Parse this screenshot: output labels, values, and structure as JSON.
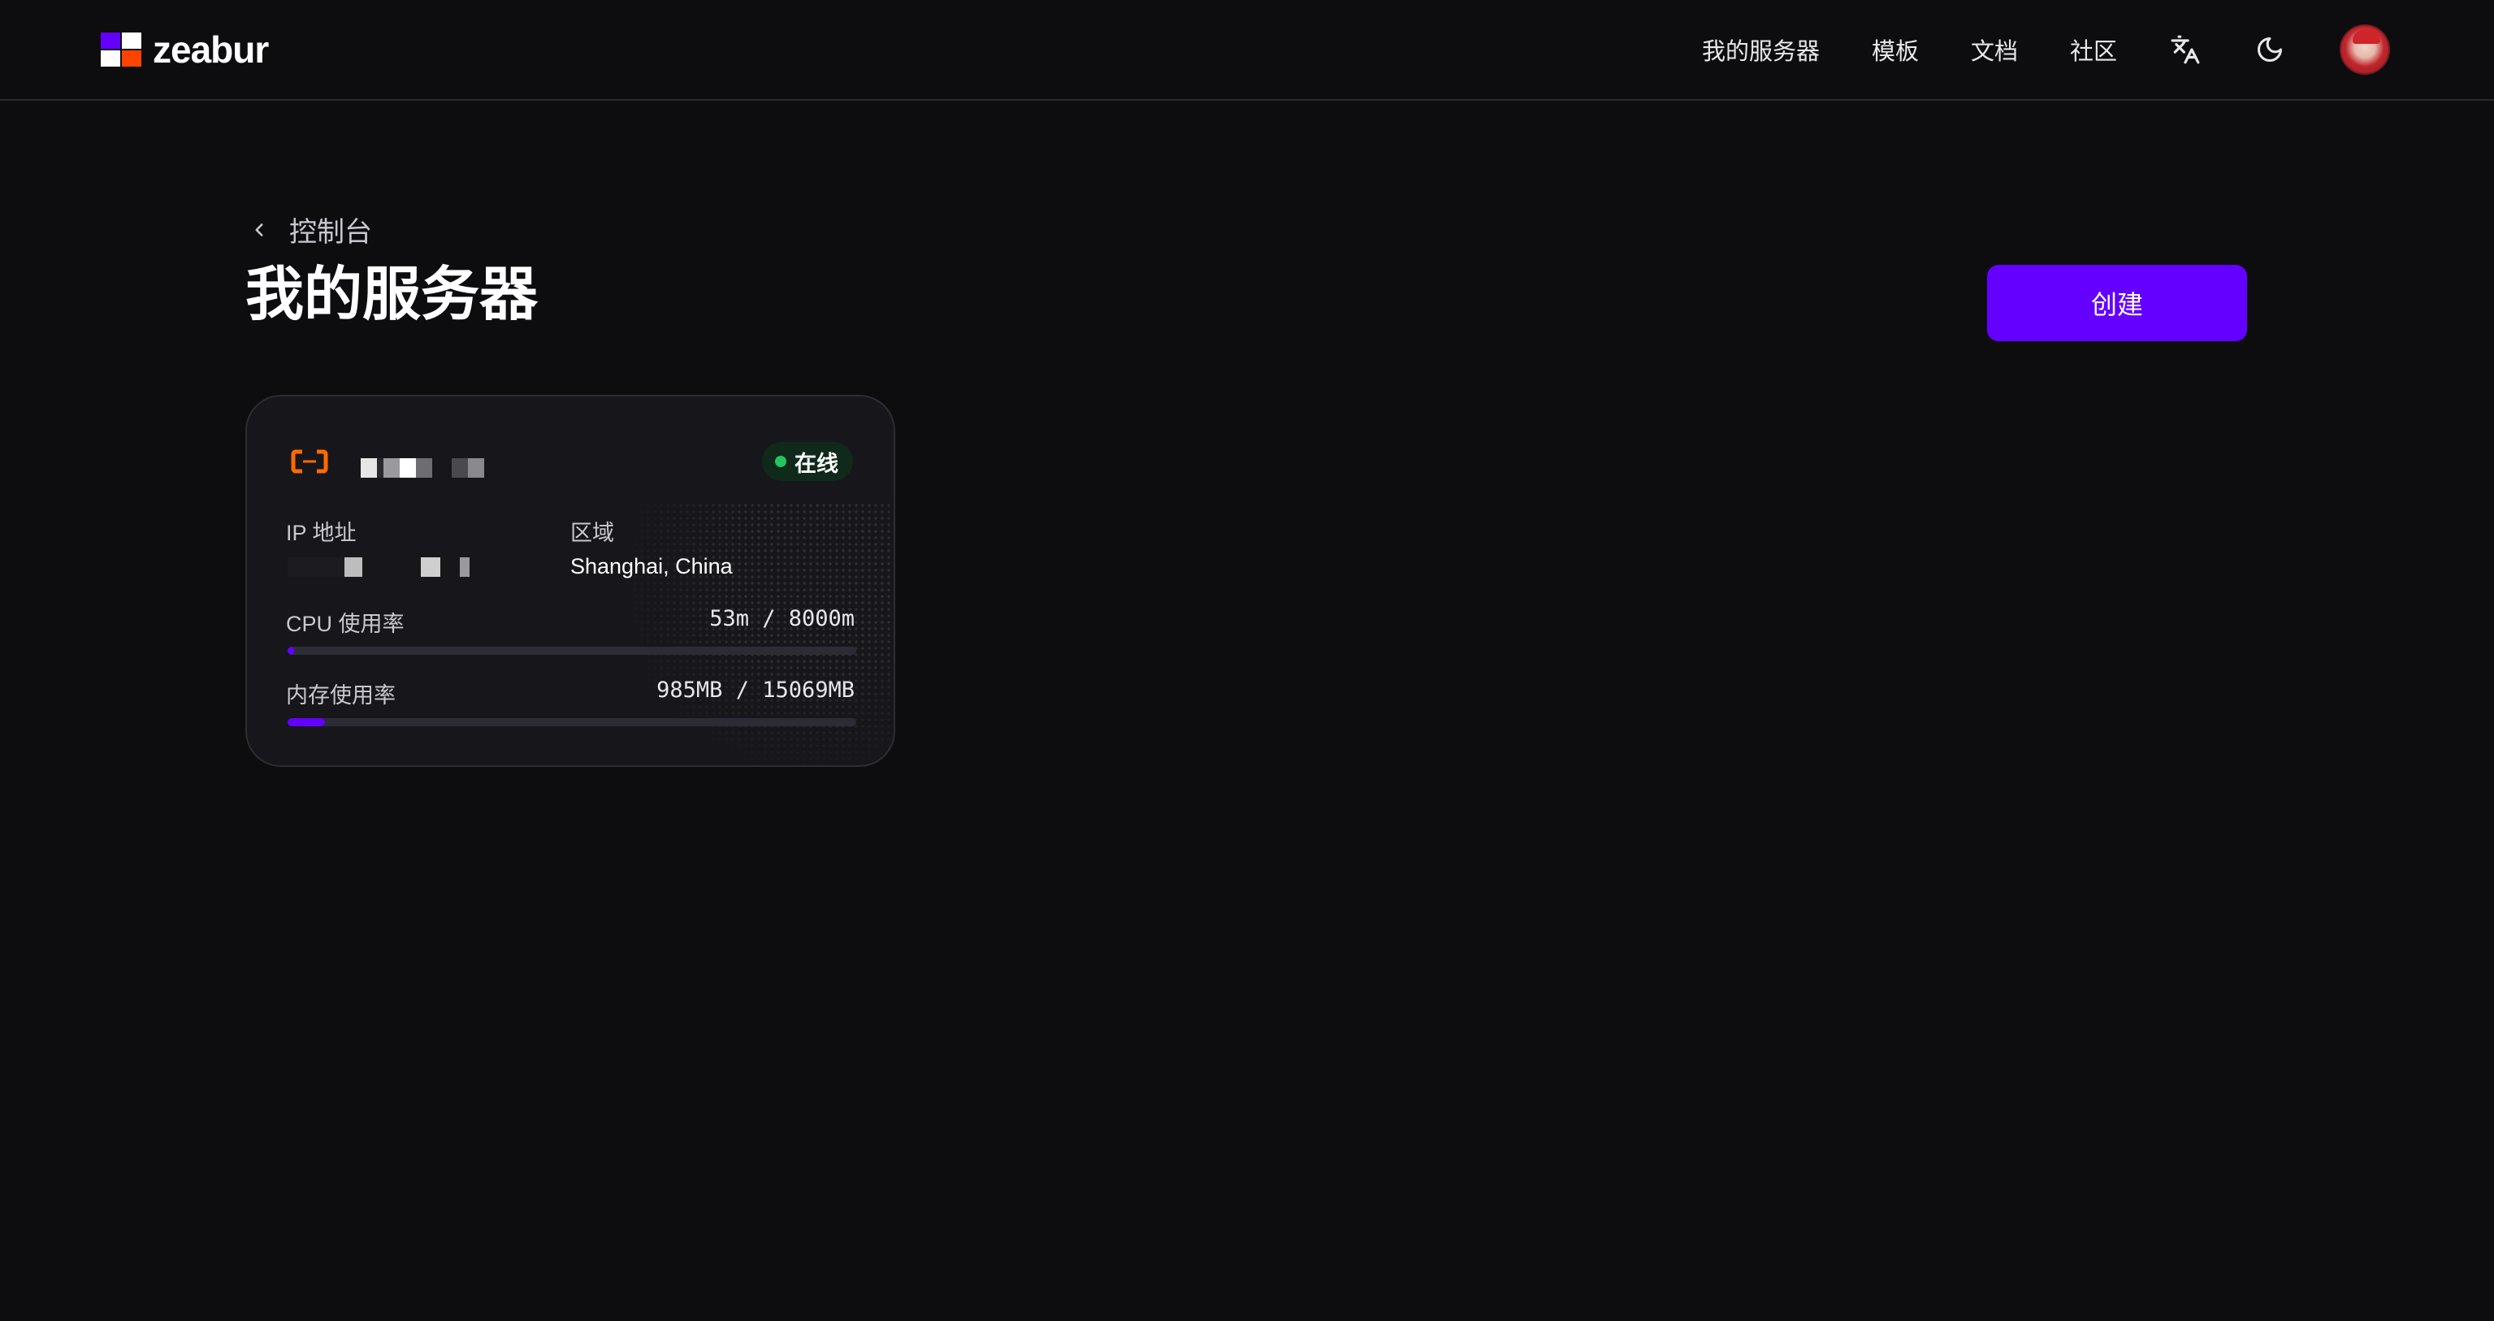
{
  "brand": {
    "name": "zeabur"
  },
  "nav": {
    "links": [
      "我的服务器",
      "模板",
      "文档",
      "社区"
    ],
    "icons": [
      "translate-icon",
      "moon-icon"
    ]
  },
  "breadcrumb": {
    "label": "控制台"
  },
  "page": {
    "title": "我的服务器",
    "create_label": "创建"
  },
  "colors": {
    "accent": "#6300ff",
    "online": "#22c55e",
    "provider": "#ff6a00"
  },
  "server": {
    "provider_icon": "aliyun-icon",
    "status": "在线",
    "ip_label": "IP 地址",
    "region_label": "区域",
    "region": "Shanghai, China",
    "cpu_label": "CPU 使用率",
    "cpu_value": "53m / 8000m",
    "cpu_fraction": 0.0066,
    "mem_label": "内存使用率",
    "mem_value": "985MB / 15069MB",
    "mem_fraction": 0.0654
  }
}
